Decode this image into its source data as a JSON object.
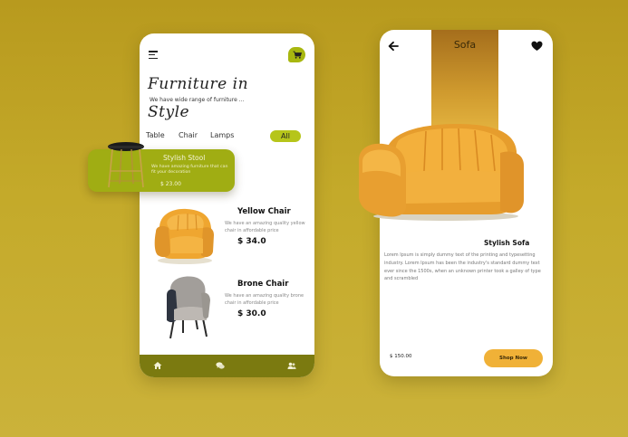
{
  "colors": {
    "background": "#c1a428",
    "accent_green": "#a8b70f",
    "nav_bar": "#7b7a10",
    "sofa_gold": "#cf9a2e",
    "shop_button": "#f0b137"
  },
  "left_screen": {
    "menu_icon": "hamburger-menu-icon",
    "cart_icon": "cart-icon",
    "title_line1": "Furniture in",
    "tagline": "We have wide range of furniture ...",
    "title_line2": "Style",
    "tabs": [
      {
        "label": "Table",
        "active": false
      },
      {
        "label": "Chair",
        "active": false
      },
      {
        "label": "Lamps",
        "active": false
      },
      {
        "label": "All",
        "active": true
      }
    ],
    "featured": {
      "title": "Stylish Stool",
      "description": "We have amazing furniture that can fit your decoration",
      "price": "$ 23.00"
    },
    "products": [
      {
        "name": "Yellow Chair",
        "description": "We have an amazing quality yellow chair in affordable price",
        "price": "$ 34.0"
      },
      {
        "name": "Brone Chair",
        "description": "We have an amazing quality brone chair in affordable price",
        "price": "$ 30.0"
      }
    ],
    "bottom_nav": [
      "home-icon",
      "chat-icon",
      "profile-icon"
    ]
  },
  "right_screen": {
    "title": "Sofa",
    "back_icon": "back-arrow-icon",
    "favorite_icon": "heart-icon",
    "product_name": "Stylish Sofa",
    "description": "Lorem Ipsum is simply dummy text of the printing and typesetting industry. Lorem Ipsum has been the industry's standard dummy text ever since the 1500s, when an unknown printer took a galley of type and scrambled",
    "price": "$ 150.00",
    "shop_button": "Shop Now"
  }
}
